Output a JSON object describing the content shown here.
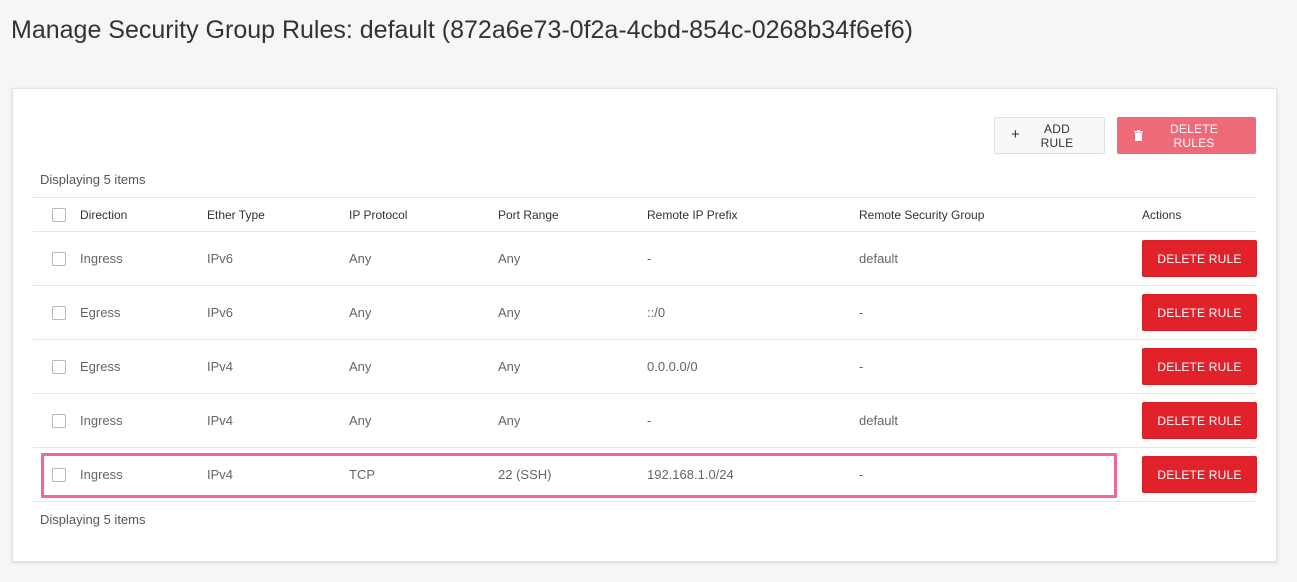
{
  "page": {
    "title": "Manage Security Group Rules: default (872a6e73-0f2a-4cbd-854c-0268b34f6ef6)"
  },
  "toolbar": {
    "add_rule_label": "ADD RULE",
    "delete_rules_label": "DELETE RULES"
  },
  "table": {
    "count_top": "Displaying 5 items",
    "count_bottom": "Displaying 5 items",
    "headers": {
      "direction": "Direction",
      "ether_type": "Ether Type",
      "ip_protocol": "IP Protocol",
      "port_range": "Port Range",
      "remote_ip_prefix": "Remote IP Prefix",
      "remote_security_group": "Remote Security Group",
      "actions": "Actions"
    },
    "rows": [
      {
        "direction": "Ingress",
        "ether_type": "IPv6",
        "ip_protocol": "Any",
        "port_range": "Any",
        "remote_ip_prefix": "-",
        "remote_security_group": "default",
        "action": "DELETE RULE"
      },
      {
        "direction": "Egress",
        "ether_type": "IPv6",
        "ip_protocol": "Any",
        "port_range": "Any",
        "remote_ip_prefix": "::/0",
        "remote_security_group": "-",
        "action": "DELETE RULE"
      },
      {
        "direction": "Egress",
        "ether_type": "IPv4",
        "ip_protocol": "Any",
        "port_range": "Any",
        "remote_ip_prefix": "0.0.0.0/0",
        "remote_security_group": "-",
        "action": "DELETE RULE"
      },
      {
        "direction": "Ingress",
        "ether_type": "IPv4",
        "ip_protocol": "Any",
        "port_range": "Any",
        "remote_ip_prefix": "-",
        "remote_security_group": "default",
        "action": "DELETE RULE"
      },
      {
        "direction": "Ingress",
        "ether_type": "IPv4",
        "ip_protocol": "TCP",
        "port_range": "22 (SSH)",
        "remote_ip_prefix": "192.168.1.0/24",
        "remote_security_group": "-",
        "action": "DELETE RULE"
      }
    ]
  },
  "icons": {
    "add": "plus-icon",
    "delete_rules": "trash-icon"
  },
  "colors": {
    "delete_rules_bg": "#ef6a78",
    "delete_rule_bg": "#e2222b",
    "highlight_border": "#f0689a"
  }
}
